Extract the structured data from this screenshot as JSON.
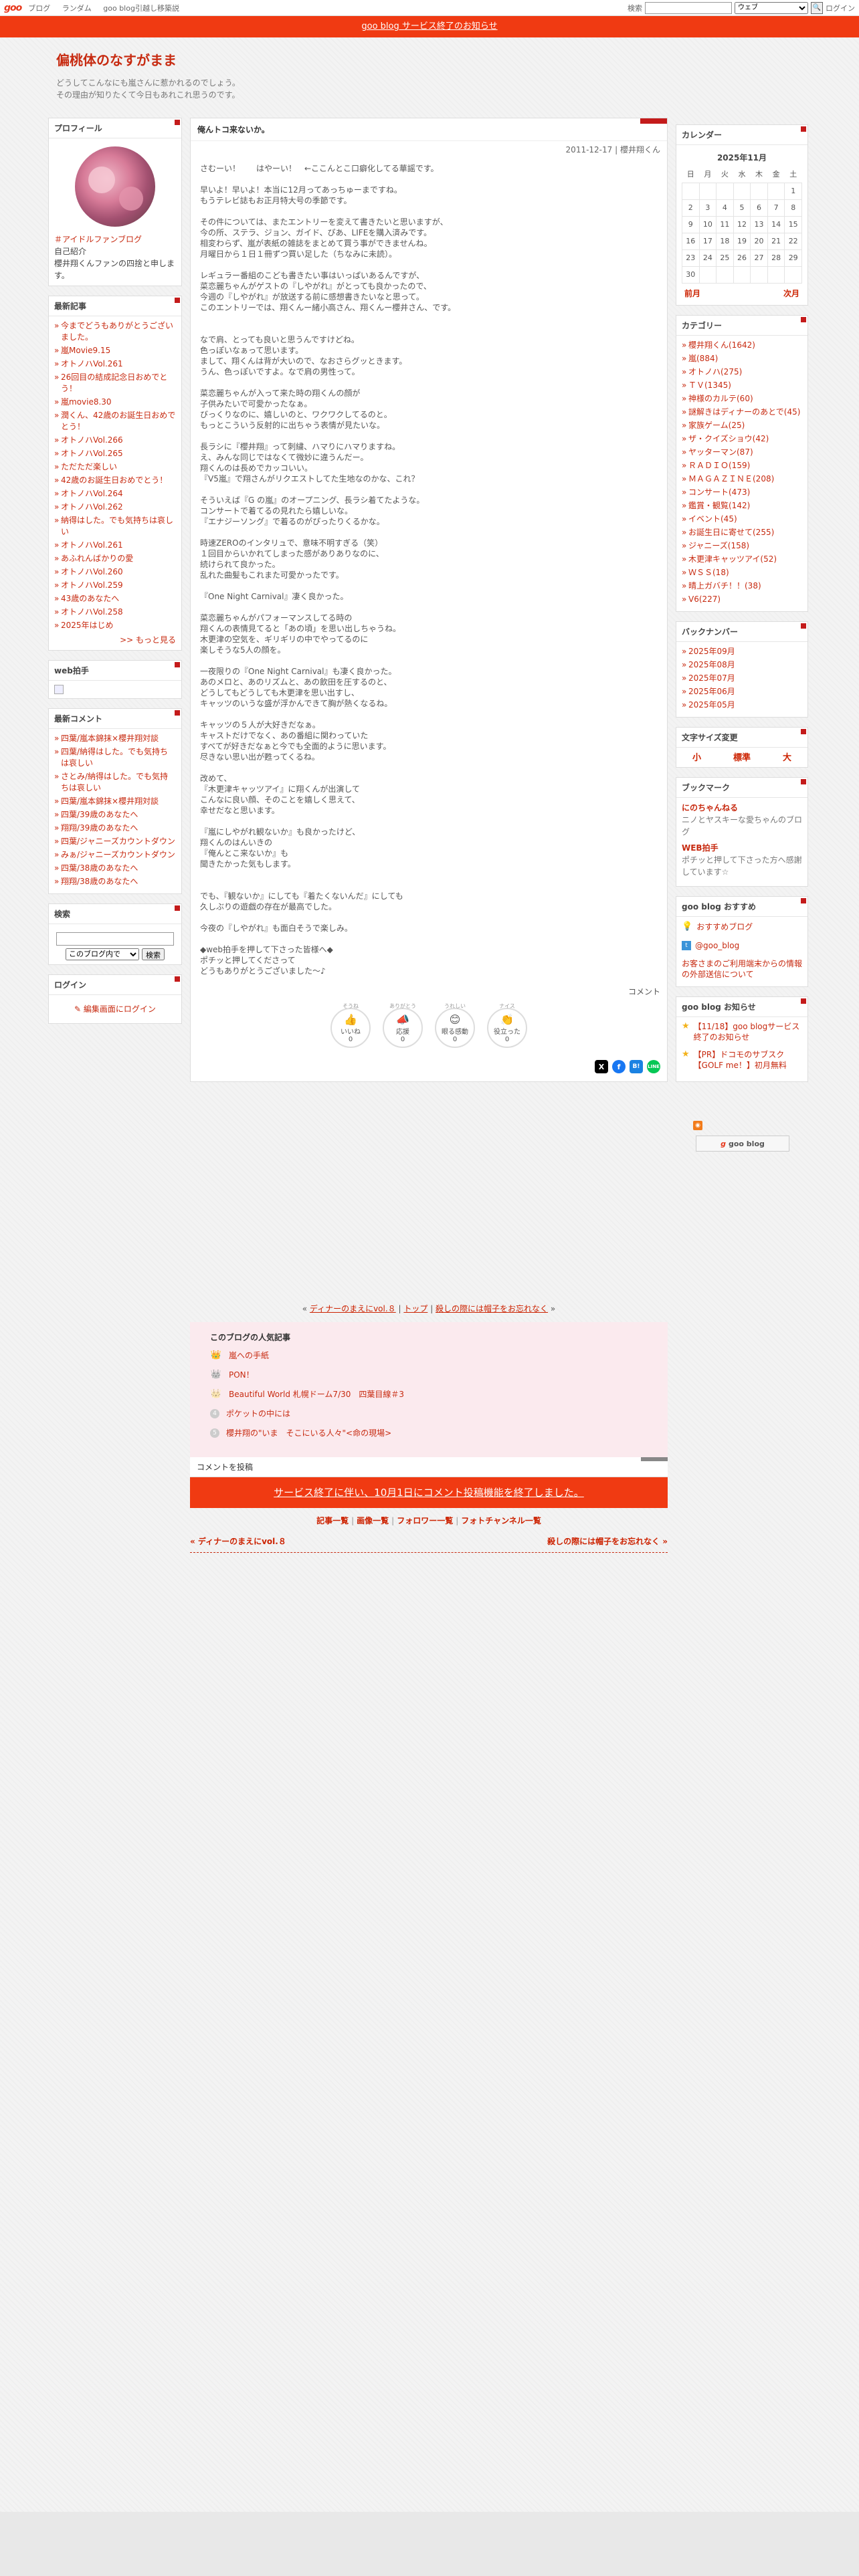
{
  "topbar": {
    "logo": "goo",
    "nav": [
      "ブログ",
      "ランダム",
      "goo blog引越し移築説"
    ],
    "search_label": "検索",
    "search_scope": "ウェブ",
    "login": "ログイン"
  },
  "notice": "goo blog サービス終了のお知らせ",
  "blog": {
    "title": "偏桃体のなすがまま",
    "desc1": "どうしてこんなにも嵐さんに惹かれるのでしょう。",
    "desc2": "その理由が知りたくて今日もあれこれ思うのです。"
  },
  "profile": {
    "title": "プロフィール",
    "blog_name": "＃アイドルファンブログ",
    "intro_label": "自己紹介",
    "intro": "櫻井翔くんファンの四捨と申します。"
  },
  "recent_posts": {
    "title": "最新記事",
    "items": [
      "今までどうもありがとうございました。",
      "嵐Movie9.15",
      "オトノハVol.261",
      "26回目の結成記念日おめでとう！",
      "嵐movie8.30",
      "潤くん、42歳のお誕生日おめでとう！",
      "オトノハVol.266",
      "オトノハVol.265",
      "ただただ楽しい",
      "42歳のお誕生日おめでとう！",
      "オトノハVol.264",
      "オトノハVol.262",
      "納得はした。でも気持ちは哀しい",
      "オトノハVol.261",
      "あふれんばかりの愛",
      "オトノハVol.260",
      "オトノハVol.259",
      "43歳のあなたへ",
      "オトノハVol.258",
      "2025年はじめ"
    ],
    "more": ">> もっと見る"
  },
  "web_clap": {
    "title": "web拍手"
  },
  "recent_comments": {
    "title": "最新コメント",
    "items": [
      "四葉/嵐本錦抹×櫻井翔対談",
      "四葉/納得はした。でも気持ちは哀しい",
      "さとみ/納得はした。でも気持ちは哀しい",
      "四葉/嵐本錦抹×櫻井翔対談",
      "四葉/39歳のあなたへ",
      "翔翔/39歳のあなたへ",
      "四葉/ジャニーズカウントダウン",
      "みぁ/ジャニーズカウントダウン",
      "四葉/38歳のあなたへ",
      "翔翔/38歳のあなたへ"
    ]
  },
  "search": {
    "title": "検索",
    "scope": "このブログ内で",
    "button": "検索"
  },
  "login": {
    "title": "ログイン",
    "link": "編集画面にログイン"
  },
  "article": {
    "title": "俺んトコ来ないか。",
    "date": "2011-12-17",
    "category": "櫻井翔くん",
    "body": "さむーい！　　はやーい！　←ここんとこ口癖化してる華謡です。\n\n早いよ！早いよ！本当に12月ってあっちゅーまですね。\nもうテレビ誌もお正月特大号の季節です。\n\nその件については、またエントリーを変えて書きたいと思いますが、\n今の所、ステラ、ジョン、ガイド、ぴあ、LIFEを購入済みです。\n相変わらず、嵐が表紙の雑誌をまとめて買う事ができませんね。\n月曜日から１日１冊ずつ買い足した（ちなみに未読）。\n\nレギュラー番組のこども書きたい事はいっぱいあるんですが、\n菜恋麗ちゃんがゲストの『しやがれ』がとっても良かったので、\n今週の『しやがれ』が放送する前に感想書きたいなと思って。\nこのエントリーでは、翔くんー緒小高さん、翔くんー櫻井さん、です。\n\n\nなで肩、とっても良いと思うんですけどね。\n色っぽいなぁって思います。\nまして、翔くんは背が大いので、なおさらグッときます。\nうん、色っぽいですよ。なで肩の男性って。\n\n菜恋麗ちゃんが入って来た時の翔くんの顔が\n子供みたいで可愛かったなぁ。\nびっくりなのに、嬉しいのと、ワクワクしてるのと。\nもっとこういう反射的に出ちゃう表情が見たいな。\n\n長ラシに『櫻井翔』って刺繍、ハマりにハマりますね。\nえ、みんな同じではなくて微妙に違うんだー。\n翔くんのは長めでカッコいい。\n『V5嵐』で翔さんがリクエストしてた生地なのかな、これ？\n\nそういえば『G の嵐』のオープニング、長ラシ着てたような。\nコンサートで着てるの見れたら嬉しいな。\n『エナジーソング』で着るのがぴったりくるかな。\n\n時速ZEROのインタリュで、意味不明すぎる（笑）\n１回目からいかれてしまった感がありありなのに、\n続けられて良かった。\n乱れた曲髪もこれまた可愛かったです。\n\n『One Night Carnival』凄く良かった。\n\n菜恋麗ちゃんがパフォーマンスしてる時の\n翔くんの表情見てると「あの頃」を思い出しちゃうね。\n木更津の空気を、ギリギリの中でやってるのに\n楽しそうな5人の顔を。\n\n一夜限りの『One Night Carnival』も凄く良かった。\nあのメロと、あのリズムと、あの飲田を圧するのと、\nどうしてもどうしても木更津を思い出すし、\nキャッツのいうな盛が浮かんできて胸が熱くなるね。\n\nキャッツの５人が大好きだなぁ。\nキャストだけでなく、あの番組に関わっていた\nすべてが好きだなぁと今でも全面的ように思います。\n尽きない思い出が甦ってくるね。\n\n改めて、\n『木更津キャッツアイ』に翔くんが出演して\nこんなに良い顔、そのことを嬉しく思えて、\n幸せだなと思います。\n\n『嵐にしやがれ観ないか』も良かったけど、\n翔くんのはんいきの\n『俺んとこ来ないか』も\n聞きたかった気もします。\n\n\nでも、『観ないか』にしても『着たくないんだ』にしても\n久しぶりの遊戯の存在が最高でした。\n\n今夜の『しやがれ』も面白そうで楽しみ。\n\n◆web拍手を押して下さった皆様へ◆\nポチッと押してくださって\nどうもありがとうございました〜♪",
    "comment": "コメント",
    "reactions": [
      {
        "top": "そうね",
        "icon": "👍",
        "label": "いいね",
        "count": "0"
      },
      {
        "top": "ありがとう",
        "icon": "📣",
        "label": "応援",
        "count": "0"
      },
      {
        "top": "うれしい",
        "icon": "😊",
        "label": "眼る感動",
        "count": "0"
      },
      {
        "top": "ナイス",
        "icon": "👏",
        "label": "役立った",
        "count": "0"
      }
    ],
    "share": [
      "X",
      "f",
      "B!",
      "LINE"
    ]
  },
  "article_nav": {
    "prev": "ディナーのまえにvol.８",
    "top": "トップ",
    "next": "殺しの際には帽子をお忘れなく"
  },
  "popular": {
    "title": "このブログの人気記事",
    "items": [
      {
        "rank": "1",
        "title": "嵐への手紙"
      },
      {
        "rank": "2",
        "title": "PON！"
      },
      {
        "rank": "3",
        "title": "Beautiful World 札幌ドーム7/30　四葉目線＃3"
      },
      {
        "rank": "4",
        "title": "ポケットの中には"
      },
      {
        "rank": "5",
        "title": "櫻井翔の\"いま　そこにいる人々\"<命の現場>"
      }
    ]
  },
  "comment_post": {
    "title": "コメントを投稿",
    "closed": "サービス終了に伴い、10月1日にコメント投稿機能を終了しました。"
  },
  "footer_links": [
    "記事一覧",
    "画像一覧",
    "フォロワー一覧",
    "フォトチャンネル一覧"
  ],
  "prevnext": {
    "prev": "« ディナーのまえにvol.８",
    "next": "殺しの際には帽子をお忘れなく »"
  },
  "calendar": {
    "title": "カレンダー",
    "month": "2025年11月",
    "weekdays": [
      "日",
      "月",
      "火",
      "水",
      "木",
      "金",
      "土"
    ],
    "rows": [
      [
        "",
        "",
        "",
        "",
        "",
        "",
        "1"
      ],
      [
        "2",
        "3",
        "4",
        "5",
        "6",
        "7",
        "8"
      ],
      [
        "9",
        "10",
        "11",
        "12",
        "13",
        "14",
        "15"
      ],
      [
        "16",
        "17",
        "18",
        "19",
        "20",
        "21",
        "22"
      ],
      [
        "23",
        "24",
        "25",
        "26",
        "27",
        "28",
        "29"
      ],
      [
        "30",
        "",
        "",
        "",
        "",
        "",
        ""
      ]
    ],
    "prev": "前月",
    "next": "次月"
  },
  "categories": {
    "title": "カテゴリー",
    "items": [
      "櫻井翔くん(1642)",
      "嵐(884)",
      "オトノハ(275)",
      "ＴＶ(1345)",
      "神様のカルテ(60)",
      "謎解きはディナーのあとで(45)",
      "家族ゲーム(25)",
      "ザ・クイズショウ(42)",
      "ヤッターマン(87)",
      "ＲＡＤＩＯ(159)",
      "ＭＡＧＡＺＩＮＥ(208)",
      "コンサート(473)",
      "鑑賞・観覧(142)",
      "イベント(45)",
      "お誕生日に寄せて(255)",
      "ジャニーズ(158)",
      "木更津キャッツアイ(52)",
      "ＷＳＳ(18)",
      "晴上ガバチ！！(38)",
      "V6(227)"
    ]
  },
  "backnumber": {
    "title": "バックナンバー",
    "items": [
      "2025年09月",
      "2025年08月",
      "2025年07月",
      "2025年06月",
      "2025年05月"
    ]
  },
  "fontsize": {
    "title": "文字サイズ変更",
    "small": "小",
    "normal": "標準",
    "large": "大"
  },
  "bookmark": {
    "title": "ブックマーク",
    "items": [
      {
        "name": "にのちゃんねる",
        "desc": "ニノとヤスキーな愛ちゃんのブログ"
      },
      {
        "name": "WEB拍手",
        "desc": "ポチッと押して下さった方へ感謝しています☆"
      }
    ]
  },
  "goo_recommend": {
    "title": "goo blog おすすめ",
    "recommend": "おすすめブログ",
    "x_account": "@goo_blog",
    "info": "お客さまのご利用端末からの情報の外部送信について"
  },
  "goo_notice": {
    "title": "goo blog お知らせ",
    "items": [
      "【11/18】goo blogサービス終了のお知らせ",
      "【PR】ドコモのサブスク【GOLF me！】初月無料"
    ]
  },
  "badge": "goo blog"
}
